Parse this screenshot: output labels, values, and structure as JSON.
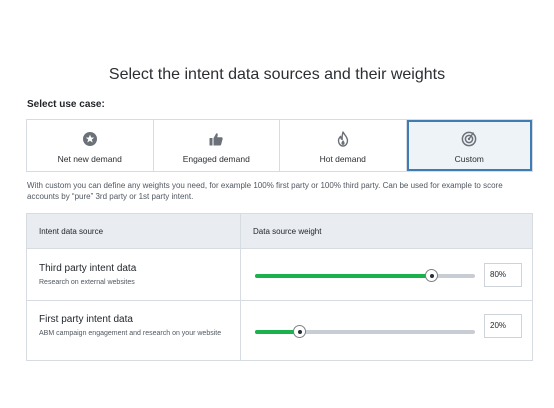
{
  "page": {
    "title": "Select the intent data sources and their weights",
    "use_case_label": "Select use case:"
  },
  "use_cases": [
    {
      "label": "Net new demand",
      "icon": "star-badge-icon",
      "selected": false
    },
    {
      "label": "Engaged demand",
      "icon": "thumbs-up-icon",
      "selected": false
    },
    {
      "label": "Hot demand",
      "icon": "flame-icon",
      "selected": false
    },
    {
      "label": "Custom",
      "icon": "target-icon",
      "selected": true
    }
  ],
  "description": "With custom you can define any weights you need, for example 100% first party or 100% third party. Can be used for example to score accounts by “pure” 3rd party or 1st party intent.",
  "table": {
    "headers": [
      "Intent data source",
      "Data source weight"
    ],
    "rows": [
      {
        "name": "Third party intent data",
        "sub": "Research on external websites",
        "weight": 80,
        "weight_label": "80%"
      },
      {
        "name": "First party intent data",
        "sub": "ABM campaign engagement and research on your website",
        "weight": 20,
        "weight_label": "20%"
      }
    ]
  },
  "colors": {
    "accent": "#3f7cb3",
    "slider_fill": "#1bb14c",
    "slider_track": "#c7cdd3",
    "header_bg": "#e9edf2",
    "selected_bg": "#eef3f8"
  }
}
